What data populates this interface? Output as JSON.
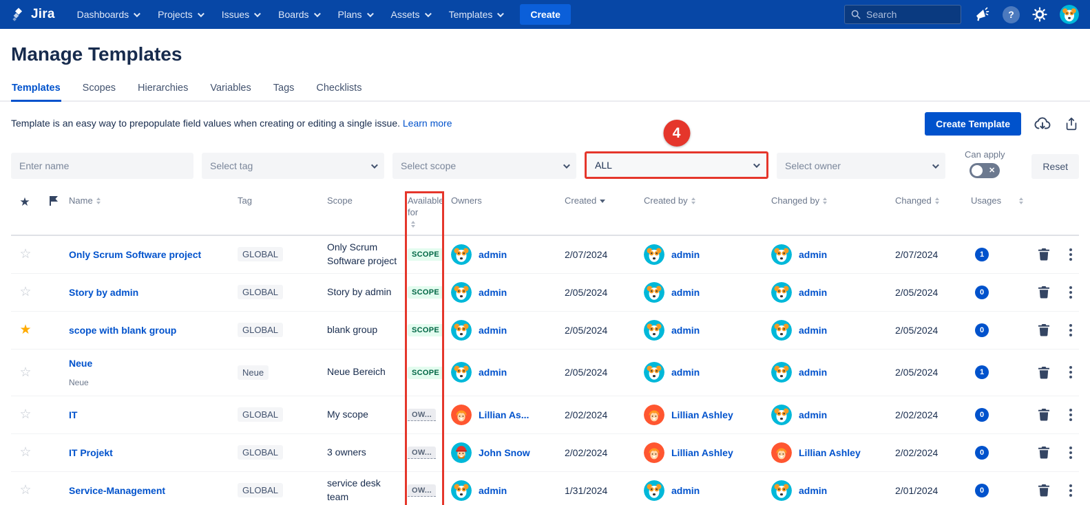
{
  "navbar": {
    "brand": "Jira",
    "items": [
      "Dashboards",
      "Projects",
      "Issues",
      "Boards",
      "Plans",
      "Assets",
      "Templates"
    ],
    "create_label": "Create",
    "search_placeholder": "Search"
  },
  "page": {
    "title": "Manage Templates",
    "tabs": [
      "Templates",
      "Scopes",
      "Hierarchies",
      "Variables",
      "Tags",
      "Checklists"
    ],
    "active_tab": "Templates",
    "description": "Template is an easy way to prepopulate field values when creating or editing a single issue.",
    "learn_more_label": "Learn more",
    "create_template_label": "Create Template"
  },
  "filters": {
    "name_placeholder": "Enter name",
    "tag_placeholder": "Select tag",
    "scope_placeholder": "Select scope",
    "available_for_value": "ALL",
    "owner_placeholder": "Select owner",
    "can_apply_label": "Can apply",
    "can_apply_state": "off",
    "reset_label": "Reset"
  },
  "annotation": {
    "step_badge": "4",
    "color": "#e5362b",
    "highlighted_filter": "available-for-dropdown",
    "highlighted_column": "Available for"
  },
  "table": {
    "headers": {
      "name": "Name",
      "tag": "Tag",
      "scope": "Scope",
      "available_for": "Available for",
      "owners": "Owners",
      "created": "Created",
      "created_by": "Created by",
      "changed_by": "Changed by",
      "changed": "Changed",
      "usages": "Usages"
    },
    "sort": {
      "active_column": "created",
      "direction": "desc"
    },
    "rows": [
      {
        "starred": false,
        "name": "Only Scrum Software project",
        "name_sub": "",
        "tag": "GLOBAL",
        "scope": "Only Scrum Software project",
        "available_for": "SCOPE",
        "available_type": "scope",
        "owner": {
          "name": "admin",
          "avatar": "dog"
        },
        "created": "2/07/2024",
        "created_by": {
          "name": "admin",
          "avatar": "dog"
        },
        "changed_by": {
          "name": "admin",
          "avatar": "dog"
        },
        "changed": "2/07/2024",
        "usages": "1"
      },
      {
        "starred": false,
        "name": "Story by admin",
        "name_sub": "",
        "tag": "GLOBAL",
        "scope": "Story by admin",
        "available_for": "SCOPE",
        "available_type": "scope",
        "owner": {
          "name": "admin",
          "avatar": "dog"
        },
        "created": "2/05/2024",
        "created_by": {
          "name": "admin",
          "avatar": "dog"
        },
        "changed_by": {
          "name": "admin",
          "avatar": "dog"
        },
        "changed": "2/05/2024",
        "usages": "0"
      },
      {
        "starred": true,
        "name": "scope with blank group",
        "name_sub": "",
        "tag": "GLOBAL",
        "scope": "blank group",
        "available_for": "SCOPE",
        "available_type": "scope",
        "owner": {
          "name": "admin",
          "avatar": "dog"
        },
        "created": "2/05/2024",
        "created_by": {
          "name": "admin",
          "avatar": "dog"
        },
        "changed_by": {
          "name": "admin",
          "avatar": "dog"
        },
        "changed": "2/05/2024",
        "usages": "0"
      },
      {
        "starred": false,
        "name": "Neue",
        "name_sub": "Neue",
        "tag": "Neue",
        "scope": "Neue Bereich",
        "available_for": "SCOPE",
        "available_type": "scope",
        "owner": {
          "name": "admin",
          "avatar": "dog"
        },
        "created": "2/05/2024",
        "created_by": {
          "name": "admin",
          "avatar": "dog"
        },
        "changed_by": {
          "name": "admin",
          "avatar": "dog"
        },
        "changed": "2/05/2024",
        "usages": "1"
      },
      {
        "starred": false,
        "name": "IT",
        "name_sub": "",
        "tag": "GLOBAL",
        "scope": "My scope",
        "available_for": "OW...",
        "available_type": "owner",
        "owner": {
          "name": "Lillian As...",
          "avatar": "lillian"
        },
        "created": "2/02/2024",
        "created_by": {
          "name": "Lillian Ashley",
          "avatar": "lillian"
        },
        "changed_by": {
          "name": "admin",
          "avatar": "dog"
        },
        "changed": "2/02/2024",
        "usages": "0"
      },
      {
        "starred": false,
        "name": "IT Projekt",
        "name_sub": "",
        "tag": "GLOBAL",
        "scope": "3 owners",
        "available_for": "OW...",
        "available_type": "owner",
        "owner": {
          "name": "John Snow",
          "avatar": "john"
        },
        "created": "2/02/2024",
        "created_by": {
          "name": "Lillian Ashley",
          "avatar": "lillian"
        },
        "changed_by": {
          "name": "Lillian Ashley",
          "avatar": "lillian"
        },
        "changed": "2/02/2024",
        "usages": "0"
      },
      {
        "starred": false,
        "name": "Service-Management",
        "name_sub": "",
        "tag": "GLOBAL",
        "scope": "service desk team",
        "available_for": "OW...",
        "available_type": "owner",
        "owner": {
          "name": "admin",
          "avatar": "dog"
        },
        "created": "1/31/2024",
        "created_by": {
          "name": "admin",
          "avatar": "dog"
        },
        "changed_by": {
          "name": "admin",
          "avatar": "dog"
        },
        "changed": "2/01/2024",
        "usages": "0"
      }
    ]
  },
  "colors": {
    "navbar_bg": "#0747a6",
    "accent_blue": "#0052cc",
    "annotation_red": "#e5362b",
    "scope_badge_bg": "#e3fcef",
    "scope_badge_text": "#006644",
    "avatar_teal": "#00b8d9",
    "avatar_orange": "#ff5630",
    "star_active": "#ffab00"
  }
}
